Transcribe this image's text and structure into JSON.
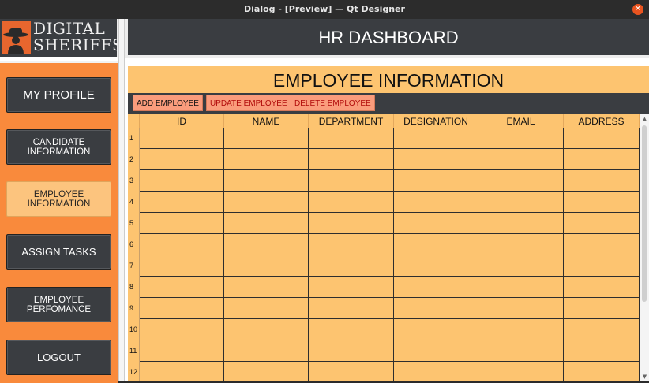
{
  "window": {
    "title": "Dialog - [Preview] — Qt Designer"
  },
  "logo": {
    "line1": "DIGITAL",
    "line2": "SHERIFFS"
  },
  "header": {
    "title": "HR DASHBOARD"
  },
  "sidebar": {
    "items": [
      {
        "label": "MY PROFILE"
      },
      {
        "label": "CANDIDATE INFORMATION"
      },
      {
        "label": "EMPLOYEE INFORMATION"
      },
      {
        "label": "ASSIGN TASKS"
      },
      {
        "label": "EMPLOYEE PERFOMANCE"
      },
      {
        "label": "LOGOUT"
      }
    ],
    "active_index": 2
  },
  "main": {
    "title": "EMPLOYEE INFORMATION",
    "toolbar": {
      "add_label": "ADD EMPLOYEE",
      "update_label": "UPDATE EMPLOYEE",
      "delete_label": "DELETE EMPLOYEE"
    },
    "table": {
      "columns": [
        "ID",
        "NAME",
        "DEPARTMENT",
        "DESIGNATION",
        "EMAIL",
        "ADDRESS"
      ],
      "row_numbers": [
        "1",
        "2",
        "3",
        "4",
        "5",
        "6",
        "7",
        "8",
        "9",
        "10",
        "11",
        "12"
      ]
    }
  },
  "colors": {
    "accent_orange": "#f98a3c",
    "table_fill": "#fdc470",
    "dark": "#3a3d41",
    "button_red": "#fa9c7c"
  }
}
